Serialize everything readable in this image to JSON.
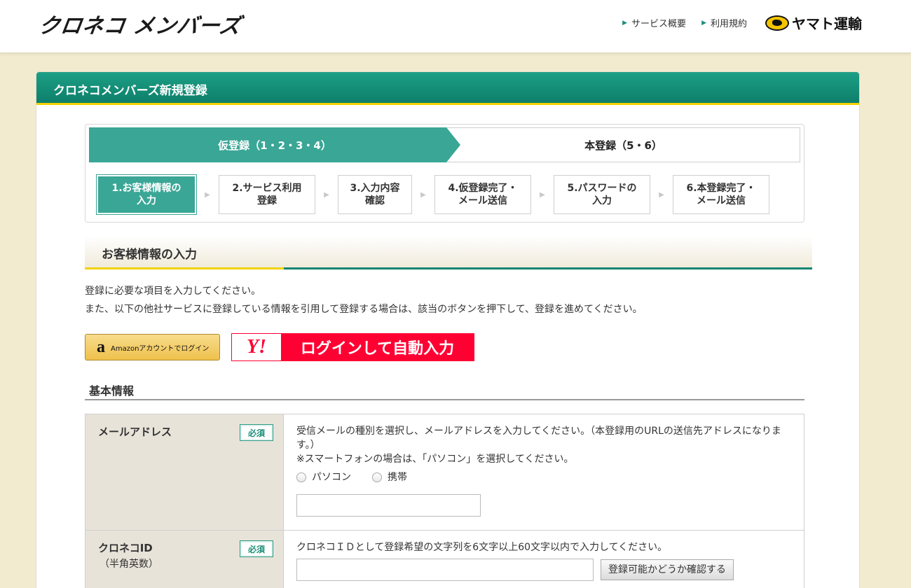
{
  "header": {
    "logo": "クロネコ メンバーズ",
    "links": [
      "サービス概要",
      "利用規約"
    ],
    "brand": "ヤマト運輸"
  },
  "panel": {
    "title": "クロネコメンバーズ新規登録"
  },
  "phases": [
    "仮登録（1・2・3・4）",
    "本登録（5・6）"
  ],
  "steps": [
    "1.お客様情報の\n入力",
    "2.サービス利用\n登録",
    "3.入力内容\n確認",
    "4.仮登録完了・\nメール送信",
    "5.パスワードの\n入力",
    "6.本登録完了・\nメール送信"
  ],
  "section": {
    "title": "お客様情報の入力",
    "intro1": "登録に必要な項目を入力してください。",
    "intro2": "また、以下の他社サービスに登録している情報を引用して登録する場合は、該当のボタンを押下して、登録を進めてください。"
  },
  "amazon": {
    "mark": "a",
    "label": "Amazonアカウントでログイン"
  },
  "yahoo": {
    "mark": "Y!",
    "label": "ログインして自動入力"
  },
  "basic": {
    "title": "基本情報"
  },
  "fields": {
    "required": "必須",
    "email": {
      "label": "メールアドレス",
      "desc1": "受信メールの種別を選択し、メールアドレスを入力してください。（本登録用のURLの送信先アドレスになります。）",
      "desc2": "※スマートフォンの場合は、「パソコン」を選択してください。",
      "options": [
        "パソコン",
        "携帯"
      ]
    },
    "id": {
      "label": "クロネコID",
      "sublabel": "（半角英数）",
      "desc": "クロネコＩＤとして登録希望の文字列を6文字以上60文字以内で入力してください。",
      "check_button": "登録可能かどうか確認する"
    }
  }
}
